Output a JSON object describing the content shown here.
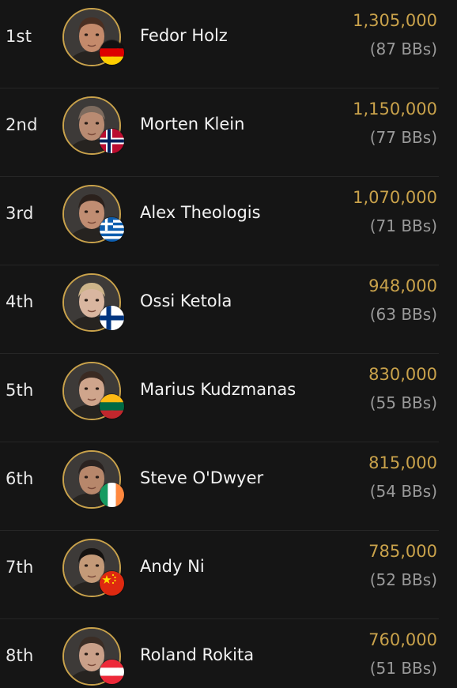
{
  "leaderboard": {
    "rows": [
      {
        "rank": "1st",
        "name": "Fedor Holz",
        "chips": "1,305,000",
        "bbs": "(87 BBs)",
        "flag": "germany-flag-icon",
        "avatar": "player-avatar-fedor-holz",
        "skin": "#c48a6b",
        "hair": "#4a2f22"
      },
      {
        "rank": "2nd",
        "name": "Morten Klein",
        "chips": "1,150,000",
        "bbs": "(77 BBs)",
        "flag": "norway-flag-icon",
        "avatar": "player-avatar-morten-klein",
        "skin": "#b98b72",
        "hair": "#7d6b5e"
      },
      {
        "rank": "3rd",
        "name": "Alex Theologis",
        "chips": "1,070,000",
        "bbs": "(71 BBs)",
        "flag": "greece-flag-icon",
        "avatar": "player-avatar-alex-theologis",
        "skin": "#c08d72",
        "hair": "#2b211c"
      },
      {
        "rank": "4th",
        "name": "Ossi Ketola",
        "chips": "948,000",
        "bbs": "(63 BBs)",
        "flag": "finland-flag-icon",
        "avatar": "player-avatar-ossi-ketola",
        "skin": "#d9b6a0",
        "hair": "#cdb48a"
      },
      {
        "rank": "5th",
        "name": "Marius Kudzmanas",
        "chips": "830,000",
        "bbs": "(55 BBs)",
        "flag": "lithuania-flag-icon",
        "avatar": "player-avatar-marius-kudzmanas",
        "skin": "#cfa58c",
        "hair": "#3a2a22"
      },
      {
        "rank": "6th",
        "name": "Steve O'Dwyer",
        "chips": "815,000",
        "bbs": "(54 BBs)",
        "flag": "ireland-flag-icon",
        "avatar": "player-avatar-steve-odwyer",
        "skin": "#b7876b",
        "hair": "#2a2220"
      },
      {
        "rank": "7th",
        "name": "Andy Ni",
        "chips": "785,000",
        "bbs": "(52 BBs)",
        "flag": "china-flag-icon",
        "avatar": "player-avatar-andy-ni",
        "skin": "#c49a78",
        "hair": "#151210"
      },
      {
        "rank": "8th",
        "name": "Roland Rokita",
        "chips": "760,000",
        "bbs": "(51 BBs)",
        "flag": "austria-flag-icon",
        "avatar": "player-avatar-roland-rokita",
        "skin": "#caa089",
        "hair": "#3b2d25"
      }
    ]
  },
  "colors": {
    "background": "#151515",
    "divider": "#262626",
    "gold": "#c9a24b",
    "name_text": "#f3f3f3",
    "muted_text": "#9a9a9a"
  }
}
